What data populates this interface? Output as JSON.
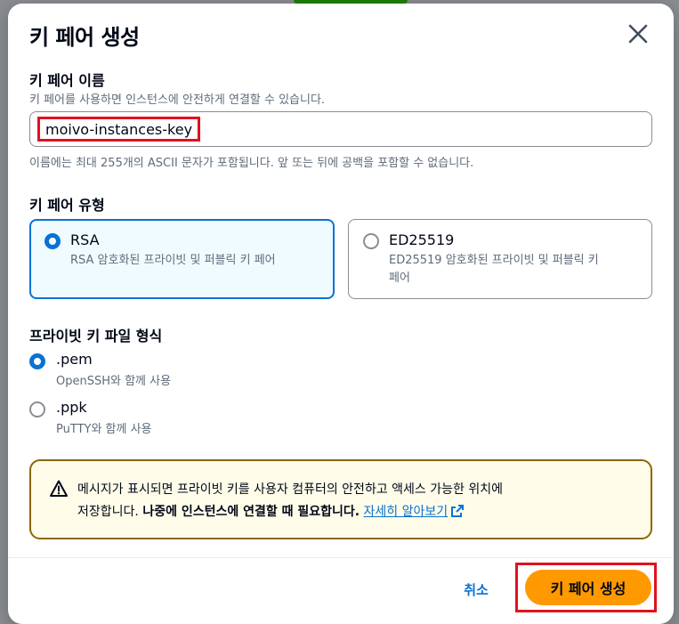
{
  "modal": {
    "title": "키 페어 생성"
  },
  "key_name": {
    "label": "키 페어 이름",
    "description": "키 페어를 사용하면 인스턴스에 안전하게 연결할 수 있습니다.",
    "value": "moivo-instances-key",
    "constraint": "이름에는 최대 255개의 ASCII 문자가 포함됩니다. 앞 또는 뒤에 공백을 포함할 수 없습니다."
  },
  "key_type": {
    "label": "키 페어 유형",
    "options": [
      {
        "title": "RSA",
        "description": "RSA 암호화된 프라이빗 및 퍼블릭 키 페어",
        "selected": true
      },
      {
        "title": "ED25519",
        "description_line1": "ED25519 암호화된 프라이빗 및 퍼블릭 키",
        "description_line2": "페어",
        "selected": false
      }
    ]
  },
  "file_format": {
    "label": "프라이빗 키 파일 형식",
    "options": [
      {
        "title": ".pem",
        "description": "OpenSSH와 함께 사용",
        "selected": true
      },
      {
        "title": ".ppk",
        "description": "PuTTY와 함께 사용",
        "selected": false
      }
    ]
  },
  "alert": {
    "text_line1": "메시지가 표시되면 프라이빗 키를 사용자 컴퓨터의 안전하고 액세스 가능한 위치에",
    "text_line2_prefix": "저장합니다. ",
    "text_bold": "나중에 인스턴스에 연결할 때 필요합니다.",
    "link": "자세히 알아보기"
  },
  "footer": {
    "cancel": "취소",
    "create": "키 페어 생성"
  },
  "colors": {
    "accent": "#0972d3",
    "primary_button": "#ff9900",
    "warning_border": "#8d6605",
    "highlight": "#e0121e"
  }
}
